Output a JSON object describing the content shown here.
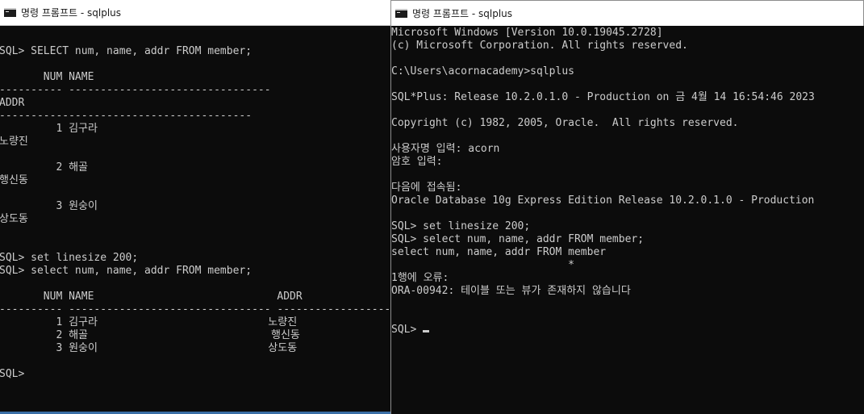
{
  "windows": {
    "left": {
      "title": "명령 프롬프트 - sqlplus",
      "lines": [
        "",
        "SQL> SELECT num, name, addr FROM member;",
        "",
        "       NUM NAME",
        "---------- --------------------------------",
        "ADDR",
        "----------------------------------------",
        "         1 김구라",
        "노량진",
        "",
        "         2 해골",
        "행신동",
        "",
        "         3 원숭이",
        "상도동",
        "",
        "",
        "SQL> set linesize 200;",
        "SQL> select num, name, addr FROM member;",
        "",
        "       NUM NAME                             ADDR",
        "---------- -------------------------------- ----------------------------------------",
        "         1 김구라                           노량진",
        "         2 해골                             행신동",
        "         3 원숭이                           상도동",
        "",
        "SQL>"
      ]
    },
    "right": {
      "title": "명령 프롬프트 - sqlplus",
      "lines": [
        "Microsoft Windows [Version 10.0.19045.2728]",
        "(c) Microsoft Corporation. All rights reserved.",
        "",
        "C:\\Users\\acornacademy>sqlplus",
        "",
        "SQL*Plus: Release 10.2.0.1.0 - Production on 금 4월 14 16:54:46 2023",
        "",
        "Copyright (c) 1982, 2005, Oracle.  All rights reserved.",
        "",
        "사용자명 입력: acorn",
        "암호 입력:",
        "",
        "다음에 접속됨:",
        "Oracle Database 10g Express Edition Release 10.2.0.1.0 - Production",
        "",
        "SQL> set linesize 200;",
        "SQL> select num, name, addr FROM member;",
        "select num, name, addr FROM member",
        "                            *",
        "1행에 오류:",
        "ORA-00942: 테이블 또는 뷰가 존재하지 않습니다",
        "",
        "",
        "SQL> "
      ]
    }
  }
}
